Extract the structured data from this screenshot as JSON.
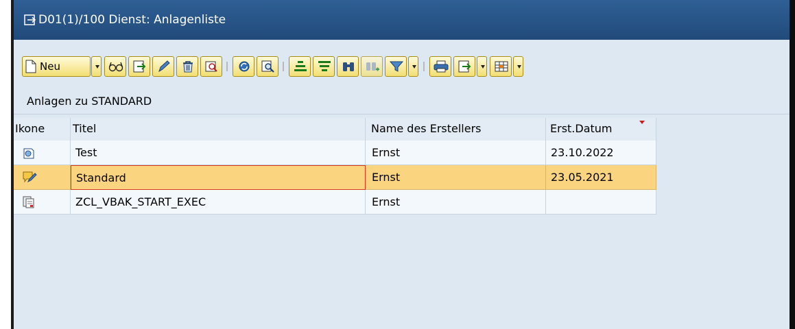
{
  "window": {
    "title": "D01(1)/100 Dienst: Anlagenliste"
  },
  "toolbar": {
    "new_label": "Neu",
    "buttons": [
      "new-icon",
      "glasses-icon",
      "export-icon",
      "pencil-icon",
      "trash-icon",
      "attachment-search-icon",
      "refresh-icon",
      "find-icon",
      "sort-ascending-icon",
      "sort-descending-icon",
      "binoculars-icon",
      "find-next-icon",
      "filter-icon",
      "print-icon",
      "export-arrow-icon",
      "layout-icon"
    ]
  },
  "subheader": {
    "text": "Anlagen zu STANDARD"
  },
  "table": {
    "headers": [
      "Ikone",
      "Titel",
      "Name des Erstellers",
      "Erst.Datum"
    ],
    "sorted_column": "Erst.Datum",
    "rows": [
      {
        "icon": "note-icon",
        "title": "Test",
        "creator": "Ernst",
        "date": "23.10.2022",
        "selected": false
      },
      {
        "icon": "edit-note-icon",
        "title": "Standard",
        "creator": "Ernst",
        "date": "23.05.2021",
        "selected": true
      },
      {
        "icon": "document-icon",
        "title": "ZCL_VBAK_START_EXEC",
        "creator": "Ernst",
        "date": "",
        "selected": false
      }
    ]
  },
  "colors": {
    "titlebar": "#2f5f95",
    "window_background": "#dde8f3",
    "toolbar_button": "#f2df73",
    "selected_row": "#fbd47f",
    "focus_border": "#d43a1d",
    "sort_indicator": "#cc1b1b"
  }
}
